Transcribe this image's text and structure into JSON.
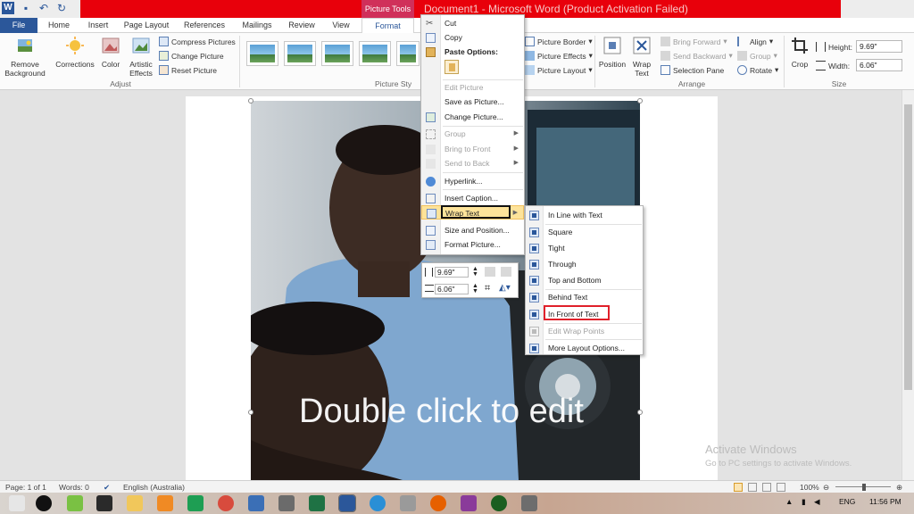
{
  "window": {
    "title": "Document1 - Microsoft Word (Product Activation Failed)",
    "context_tab_header": "Picture Tools"
  },
  "tabs": [
    "File",
    "Home",
    "Insert",
    "Page Layout",
    "References",
    "Mailings",
    "Review",
    "View",
    "Format"
  ],
  "ribbon": {
    "adjust": {
      "remove_background": "Remove Background",
      "corrections": "Corrections",
      "color": "Color",
      "artistic_effects": "Artistic Effects",
      "compress": "Compress Pictures",
      "change": "Change Picture",
      "reset": "Reset Picture",
      "group_label": "Adjust"
    },
    "picture_styles_label": "Picture Sty",
    "picture_border": "Picture Border",
    "picture_effects": "Picture Effects",
    "picture_layout": "Picture Layout",
    "arrange": {
      "position": "Position",
      "wrap_text": "Wrap Text",
      "bring_forward": "Bring Forward",
      "send_backward": "Send Backward",
      "selection_pane": "Selection Pane",
      "align": "Align",
      "group": "Group",
      "rotate": "Rotate",
      "group_label": "Arrange"
    },
    "size": {
      "crop": "Crop",
      "height_label": "Height:",
      "height_value": "9.69\"",
      "width_label": "Width:",
      "width_value": "6.06\"",
      "group_label": "Size"
    }
  },
  "context_menu": {
    "cut": "Cut",
    "copy": "Copy",
    "paste_options": "Paste Options:",
    "edit_picture": "Edit Picture",
    "save_as_picture": "Save as Picture...",
    "change_picture": "Change Picture...",
    "group": "Group",
    "bring_to_front": "Bring to Front",
    "send_to_back": "Send to Back",
    "hyperlink": "Hyperlink...",
    "insert_caption": "Insert Caption...",
    "wrap_text": "Wrap Text",
    "size_and_position": "Size and Position...",
    "format_picture": "Format Picture..."
  },
  "mini_toolbar": {
    "height_value": "9.69\"",
    "width_value": "6.06\""
  },
  "wrap_submenu": {
    "in_line_with_text": "In Line with Text",
    "square": "Square",
    "tight": "Tight",
    "through": "Through",
    "top_and_bottom": "Top and Bottom",
    "behind_text": "Behind Text",
    "in_front_of_text": "In Front of Text",
    "edit_wrap_points": "Edit Wrap Points",
    "more_layout_options": "More Layout Options..."
  },
  "document": {
    "overlay_text": "Double click to edit",
    "watermark_line1": "Activate Windows",
    "watermark_line2": "Go to PC settings to activate Windows."
  },
  "status_bar": {
    "page": "Page: 1 of 1",
    "words": "Words: 0",
    "language": "English (Australia)",
    "zoom": "100%"
  },
  "taskbar": {
    "language": "ENG",
    "time": "11:56 PM"
  },
  "colors": {
    "title_red": "#e8000b",
    "picture_tools": "#d0305a",
    "word_blue": "#2b579a",
    "highlight_outline_red": "#e0202a"
  }
}
